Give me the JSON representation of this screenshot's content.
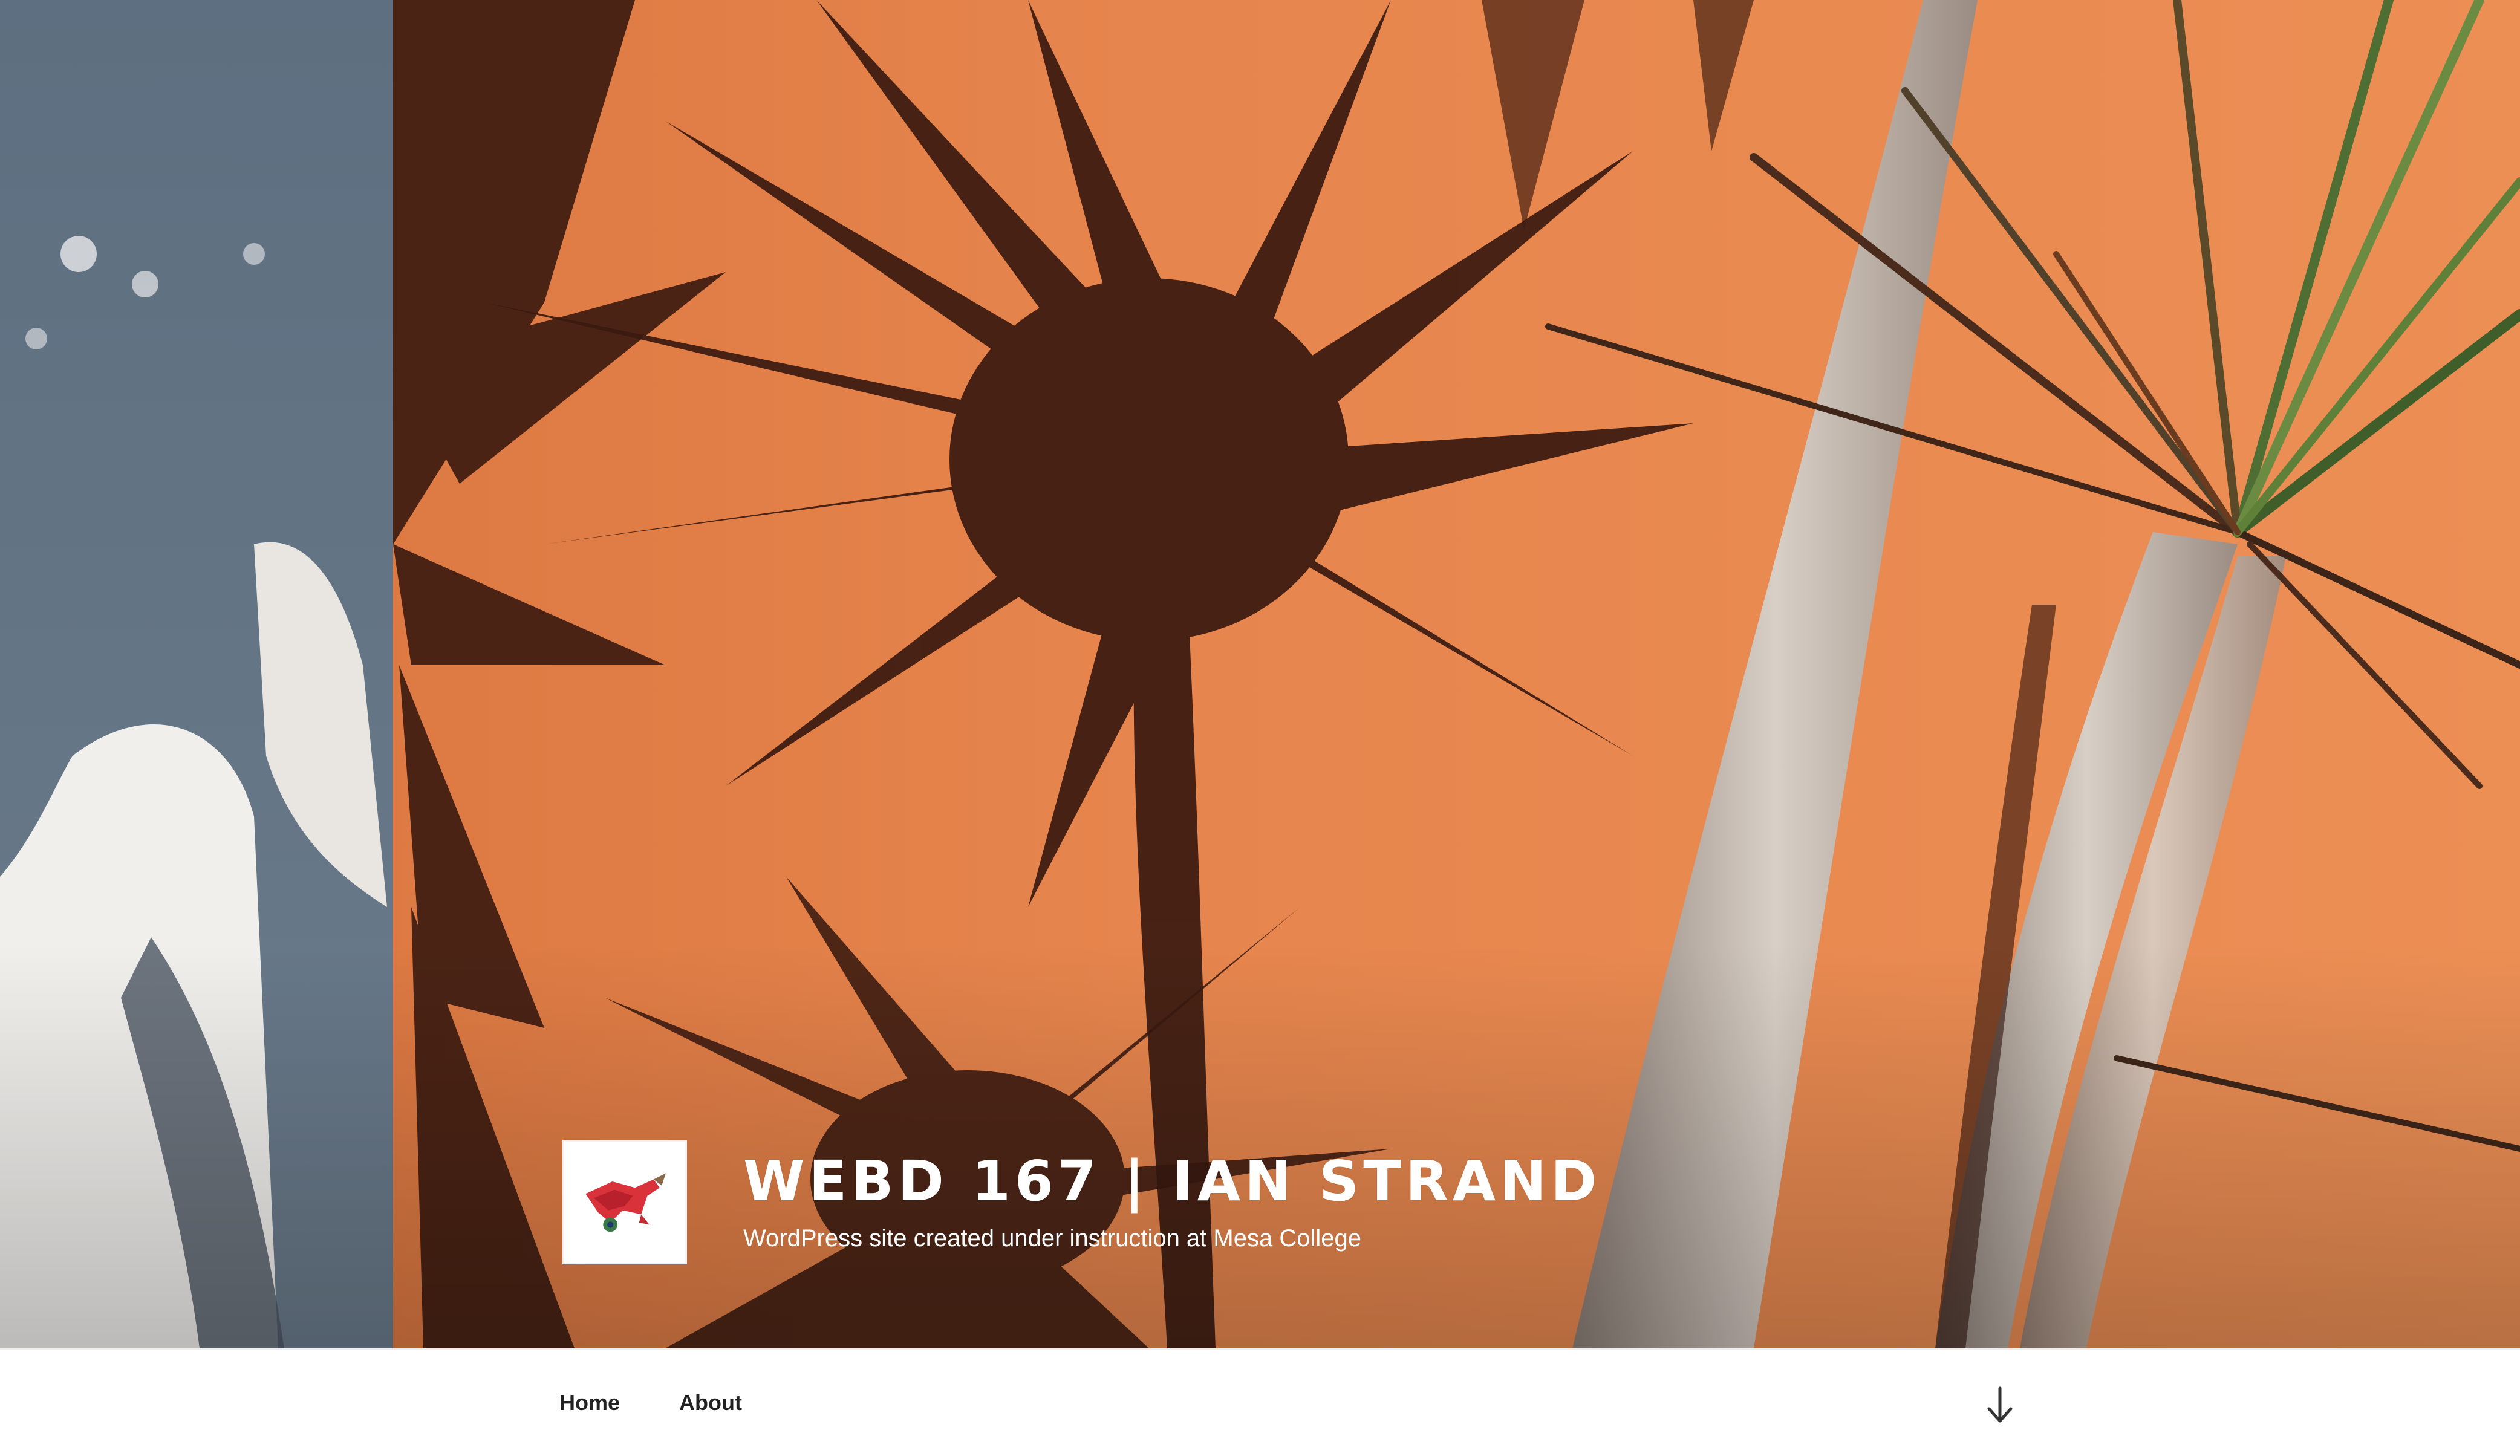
{
  "site": {
    "title": "WEBD 167 | IAN STRAND",
    "description": "WordPress site created under instruction at Mesa College"
  },
  "logo": {
    "icon": "site-logo-red-creature-icon"
  },
  "navigation": {
    "items": [
      {
        "label": "Home"
      },
      {
        "label": "About"
      }
    ],
    "scroll_icon": "arrow-down-icon"
  },
  "colors": {
    "wall_orange": "#e88a4f",
    "wall_blue_gray": "#5f7081",
    "shadow": "#3a1a10",
    "nav_text": "#222222",
    "title_text": "#ffffff"
  }
}
